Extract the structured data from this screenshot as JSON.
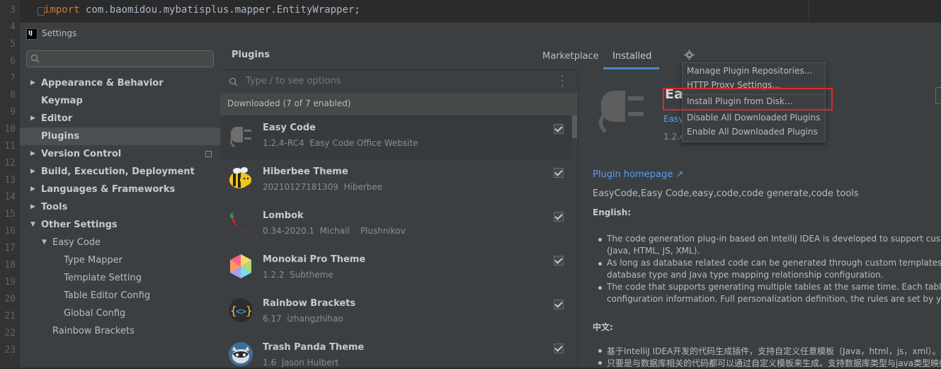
{
  "editor": {
    "line_numbers": [
      "3",
      "4",
      "5",
      "6",
      "7",
      "8",
      "9",
      "10",
      "11",
      "12",
      "13",
      "14",
      "15",
      "16",
      "17",
      "18",
      "19",
      "20",
      "21",
      "22",
      "23"
    ],
    "code_keyword": "import",
    "code_rest": " com.baomidou.mybatisplus.mapper.EntityWrapper;"
  },
  "dialog": {
    "app_icon": "intellij-icon",
    "title": "Settings"
  },
  "sidebar": {
    "search_icon": "search-icon",
    "items": [
      {
        "label": "Appearance & Behavior",
        "arrow": "▶",
        "bold": true
      },
      {
        "label": "Keymap",
        "arrow": "",
        "bold": true
      },
      {
        "label": "Editor",
        "arrow": "▶",
        "bold": true
      },
      {
        "label": "Plugins",
        "arrow": "",
        "bold": true,
        "selected": true
      },
      {
        "label": "Version Control",
        "arrow": "▶",
        "bold": true
      },
      {
        "label": "Build, Execution, Deployment",
        "arrow": "▶",
        "bold": true
      },
      {
        "label": "Languages & Frameworks",
        "arrow": "▶",
        "bold": true
      },
      {
        "label": "Tools",
        "arrow": "▶",
        "bold": true
      },
      {
        "label": "Other Settings",
        "arrow": "▼",
        "bold": true
      },
      {
        "label": "Easy Code",
        "arrow": "▼",
        "bold": false
      },
      {
        "label": "Type Mapper",
        "arrow": "",
        "bold": false
      },
      {
        "label": "Template Setting",
        "arrow": "",
        "bold": false
      },
      {
        "label": "Table Editor Config",
        "arrow": "",
        "bold": false
      },
      {
        "label": "Global Config",
        "arrow": "",
        "bold": false
      },
      {
        "label": "Rainbow Brackets",
        "arrow": "",
        "bold": false
      }
    ]
  },
  "plugins": {
    "title": "Plugins",
    "tabs": [
      "Marketplace",
      "Installed"
    ],
    "active_tab": "Installed",
    "settings_icon": "gear-icon",
    "search_placeholder": "Type / to see options",
    "more_icon": "more-vertical-icon",
    "section_label": "Downloaded (7 of 7 enabled)",
    "list": [
      {
        "name": "Easy Code",
        "meta": "1.2.4-RC4  Easy Code Office Website",
        "icon": "plug-icon",
        "enabled": true
      },
      {
        "name": "Hiberbee Theme",
        "meta": "20210127181309  Hiberbee",
        "icon": "bee-icon",
        "enabled": true
      },
      {
        "name": "Lombok",
        "meta": "0.34-2020.1  Michail    Plushnikov",
        "icon": "chili-pepper-icon",
        "enabled": true
      },
      {
        "name": "Monokai Pro Theme",
        "meta": "1.2.2  Subtheme",
        "icon": "hexagon-icon",
        "enabled": true
      },
      {
        "name": "Rainbow Brackets",
        "meta": "6.17  izhangzhihao",
        "icon": "brackets-icon",
        "enabled": true
      },
      {
        "name": "Trash Panda Theme",
        "meta": "1.6  Jason Hulbert",
        "icon": "raccoon-icon",
        "enabled": true
      }
    ]
  },
  "details": {
    "name": "Eas",
    "vendor_link": "Easy",
    "version": "1.2.4",
    "homepage": "Plugin homepage ↗",
    "tags": "EasyCode,Easy Code,easy,code,code generate,code tools",
    "english_heading": "English:",
    "bullets": [
      {
        "l1": "The code generation plug-in based on IntelliJ IDEA is developed to support custo",
        "l2": "(Java, HTML, JS, XML)."
      },
      {
        "l1": "As long as database related code can be generated through custom templates. S",
        "l2": "database type and Java type mapping relationship configuration."
      },
      {
        "l1": "The code that supports generating multiple tables at the same time. Each table h",
        "l2": "configuration information. Full personalization definition, the rules are set by you."
      }
    ],
    "chinese_heading": "中文:",
    "cn_bullets": [
      "基于IntelliJ IDEA开发的代码生成插件，支持自定义任意模板（Java，html，js，xml）。",
      "只要是与数据库相关的代码都可以通过自定义模板来生成。支持数据库类型与java类型映射"
    ]
  },
  "gear_menu": {
    "items": [
      "Manage Plugin Repositories...",
      "HTTP Proxy Settings...",
      "Install Plugin from Disk...",
      "Disable All Downloaded Plugins",
      "Enable All Downloaded Plugins"
    ],
    "highlighted": "Install Plugin from Disk..."
  },
  "colors": {
    "accent": "#4a88c7",
    "link": "#589df6",
    "highlight_box": "#e1262a",
    "dialog_bg": "#3c3f41"
  }
}
